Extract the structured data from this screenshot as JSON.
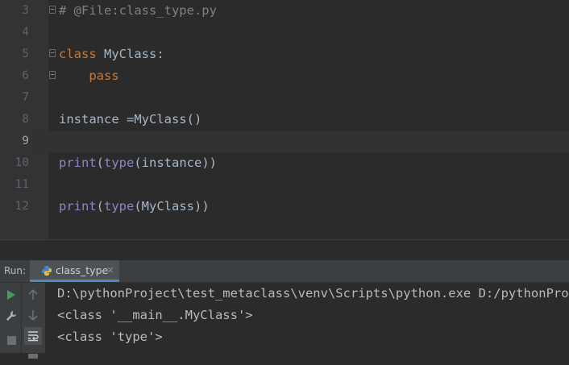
{
  "editor": {
    "lines": [
      {
        "num": "3",
        "parts": [
          {
            "t": "# @File:class_type.py",
            "c": "cm"
          }
        ],
        "fold": true,
        "current": false
      },
      {
        "num": "4",
        "parts": [],
        "fold": false,
        "current": false
      },
      {
        "num": "5",
        "parts": [
          {
            "t": "class",
            "c": "kw"
          },
          {
            "t": " MyClass:",
            "c": "id"
          }
        ],
        "fold": true,
        "current": false
      },
      {
        "num": "6",
        "parts": [
          {
            "t": "    pass",
            "c": "kw"
          }
        ],
        "fold": true,
        "current": false
      },
      {
        "num": "7",
        "parts": [],
        "fold": false,
        "current": false
      },
      {
        "num": "8",
        "parts": [
          {
            "t": "instance =MyClass()",
            "c": "id"
          }
        ],
        "fold": false,
        "current": false
      },
      {
        "num": "9",
        "parts": [],
        "fold": false,
        "current": true
      },
      {
        "num": "10",
        "parts": [
          {
            "t": "print",
            "c": "bi"
          },
          {
            "t": "(",
            "c": "id"
          },
          {
            "t": "type",
            "c": "bi"
          },
          {
            "t": "(instance))",
            "c": "id"
          }
        ],
        "fold": false,
        "current": false
      },
      {
        "num": "11",
        "parts": [],
        "fold": false,
        "current": false
      },
      {
        "num": "12",
        "parts": [
          {
            "t": "print",
            "c": "bi"
          },
          {
            "t": "(",
            "c": "id"
          },
          {
            "t": "type",
            "c": "bi"
          },
          {
            "t": "(MyClass))",
            "c": "id"
          }
        ],
        "fold": false,
        "current": false
      }
    ]
  },
  "run_panel": {
    "title": "Run:",
    "tab_label": "class_type",
    "tab_close": "×",
    "output": [
      "D:\\pythonProject\\test_metaclass\\venv\\Scripts\\python.exe D:/pythonProject/test_metaclass/class_type.py",
      "<class '__main__.MyClass'>",
      "<class 'type'>"
    ]
  },
  "colors": {
    "editor_bg": "#2b2b2b",
    "keyword": "#cc7832",
    "builtin": "#8888c6",
    "comment": "#808080",
    "run_green": "#499c54",
    "tab_underline": "#4a88c7"
  },
  "icons": {
    "run": "run-icon",
    "up": "arrow-up-icon",
    "down": "arrow-down-icon",
    "settings": "wrench-icon",
    "soft_wrap": "soft-wrap-icon",
    "stop": "stop-icon",
    "python": "python-icon"
  }
}
